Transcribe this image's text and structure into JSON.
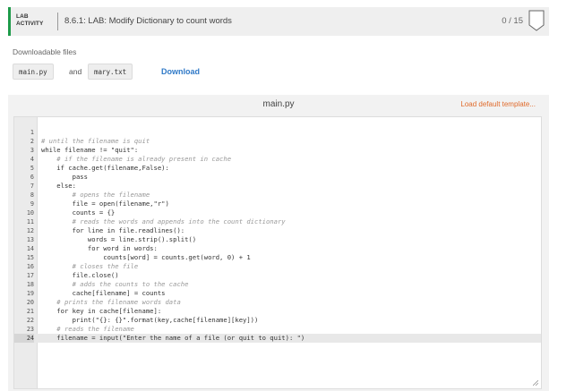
{
  "header": {
    "lab_tag_1": "LAB",
    "lab_tag_2": "ACTIVITY",
    "title": "8.6.1: LAB: Modify Dictionary to count words",
    "score": "0 / 15"
  },
  "downloads": {
    "label": "Downloadable files",
    "file1": "main.py",
    "and": "and",
    "file2": "mary.txt",
    "download": "Download"
  },
  "editor": {
    "title": "main.py",
    "load_default": "Load default template...",
    "active_line": 24,
    "lines": [
      {
        "n": "1",
        "code": ""
      },
      {
        "n": "2",
        "code": "# until the filename is quit"
      },
      {
        "n": "3",
        "code": "while filename != \"quit\":"
      },
      {
        "n": "4",
        "code": "    # if the filename is already present in cache"
      },
      {
        "n": "5",
        "code": "    if cache.get(filename,False):"
      },
      {
        "n": "6",
        "code": "        pass"
      },
      {
        "n": "7",
        "code": "    else:"
      },
      {
        "n": "8",
        "code": "        # opens the filename"
      },
      {
        "n": "9",
        "code": "        file = open(filename,\"r\")"
      },
      {
        "n": "10",
        "code": "        counts = {}"
      },
      {
        "n": "11",
        "code": "        # reads the words and appends into the count dictionary"
      },
      {
        "n": "12",
        "code": "        for line in file.readlines():"
      },
      {
        "n": "13",
        "code": "            words = line.strip().split()"
      },
      {
        "n": "14",
        "code": "            for word in words:"
      },
      {
        "n": "15",
        "code": "                counts[word] = counts.get(word, 0) + 1"
      },
      {
        "n": "16",
        "code": "        # closes the file"
      },
      {
        "n": "17",
        "code": "        file.close()"
      },
      {
        "n": "18",
        "code": "        # adds the counts to the cache"
      },
      {
        "n": "19",
        "code": "        cache[filename] = counts"
      },
      {
        "n": "20",
        "code": "    # prints the filename words data"
      },
      {
        "n": "21",
        "code": "    for key in cache[filename]:"
      },
      {
        "n": "22",
        "code": "        print(\"{}: {}\".format(key,cache[filename][key]))"
      },
      {
        "n": "23",
        "code": "    # reads the filename"
      },
      {
        "n": "24",
        "code": "    filename = input(\"Enter the name of a file (or quit to quit): \")"
      }
    ]
  },
  "colors": {
    "accent_green": "#1e9b4a",
    "link_blue": "#2f79c7",
    "load_orange": "#e06a2b"
  }
}
